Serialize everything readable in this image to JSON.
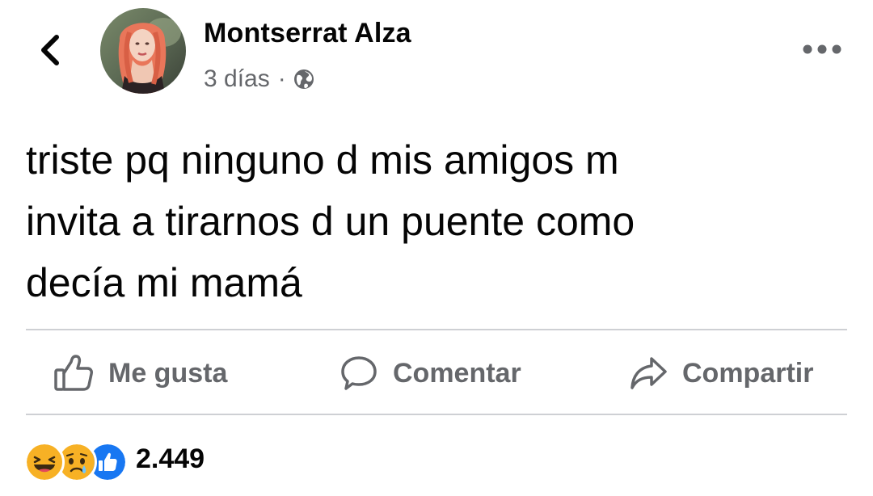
{
  "header": {
    "back_icon": "chevron-left-icon",
    "author_name": "Montserrat Alza",
    "timestamp": "3 días",
    "separator": "·",
    "audience_icon": "globe-icon",
    "more_icon": "more-horizontal-icon"
  },
  "post": {
    "lines": [
      "triste pq ninguno d mis amigos m",
      "invita a tirarnos d un puente como",
      "decía mi mamá"
    ]
  },
  "actions": {
    "like_label": "Me gusta",
    "comment_label": "Comentar",
    "share_label": "Compartir"
  },
  "reactions": {
    "icons": [
      "haha-reaction-icon",
      "sad-reaction-icon",
      "like-reaction-icon"
    ],
    "count": "2.449"
  },
  "colors": {
    "text_primary": "#050505",
    "text_secondary": "#65676b",
    "divider": "#ced0d4",
    "like_blue": "#1877f2",
    "reaction_yellow": "#f7b125"
  }
}
